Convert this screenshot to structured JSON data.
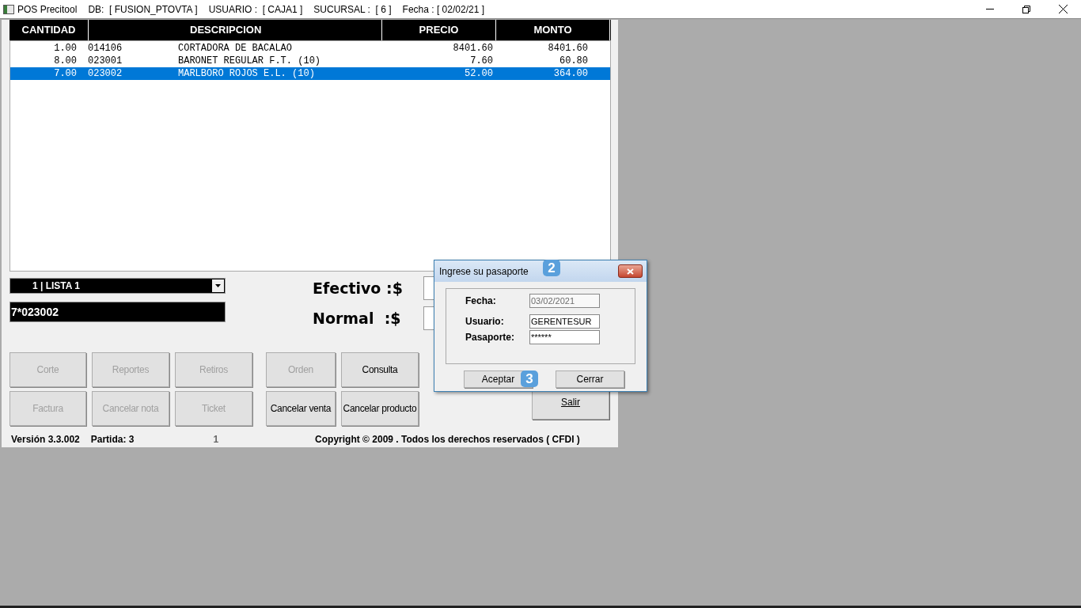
{
  "window": {
    "title_parts": [
      "POS Precitool",
      "DB:  [ FUSION_PTOVTA ]",
      "USUARIO :  [ CAJA1 ]",
      "SUCURSAL :  [ 6 ]",
      "Fecha : [ 02/02/21 ]"
    ]
  },
  "table": {
    "columns": [
      "CANTIDAD",
      "DESCRIPCION",
      "PRECIO",
      "MONTO"
    ],
    "rows": [
      {
        "cantidad": "1.00",
        "codigo": "014106",
        "descripcion": "CORTADORA DE BACALAO",
        "precio": "8401.60",
        "monto": "8401.60",
        "selected": false
      },
      {
        "cantidad": "8.00",
        "codigo": "023001",
        "descripcion": "BARONET REGULAR F.T. (10)",
        "precio": "7.60",
        "monto": "60.80",
        "selected": false
      },
      {
        "cantidad": "7.00",
        "codigo": "023002",
        "descripcion": "MARLBORO ROJOS E.L. (10)",
        "precio": "52.00",
        "monto": "364.00",
        "selected": true
      }
    ]
  },
  "price_list": {
    "value": "1  | LISTA 1"
  },
  "code_input": {
    "value": "7*023002"
  },
  "totals": [
    {
      "label": "Efectivo :$"
    },
    {
      "label": "Normal  :$"
    }
  ],
  "buttons": [
    {
      "label": "Corte",
      "disabled": true
    },
    {
      "label": "Reportes",
      "disabled": true
    },
    {
      "label": "Retiros",
      "disabled": true
    },
    {
      "label": "Orden",
      "disabled": true
    },
    {
      "label": "Consulta",
      "disabled": false
    },
    {
      "label": "Factura",
      "disabled": true
    },
    {
      "label": "Cancelar nota",
      "disabled": true
    },
    {
      "label": "Ticket",
      "disabled": true
    },
    {
      "label": "Cancelar venta",
      "disabled": false
    },
    {
      "label": "Cancelar producto",
      "disabled": false
    }
  ],
  "exit_button": {
    "label": "Salir"
  },
  "status": {
    "version": "Versión 3.3.002",
    "partida": "Partida: 3",
    "counter": "1",
    "copyright": "Copyright © 2009 . Todos los derechos reservados ( CFDI )"
  },
  "dialog": {
    "title": "Ingrese su pasaporte",
    "title_badge": "2",
    "fields": [
      {
        "label": "Fecha:",
        "value": "03/02/2021",
        "disabled": true
      },
      {
        "label": "Usuario:",
        "value": "GERENTESUR",
        "disabled": false
      },
      {
        "label": "Pasaporte:",
        "value": "******",
        "disabled": false
      }
    ],
    "buttons": [
      "Aceptar",
      "Cerrar"
    ],
    "button_badge": "3"
  }
}
